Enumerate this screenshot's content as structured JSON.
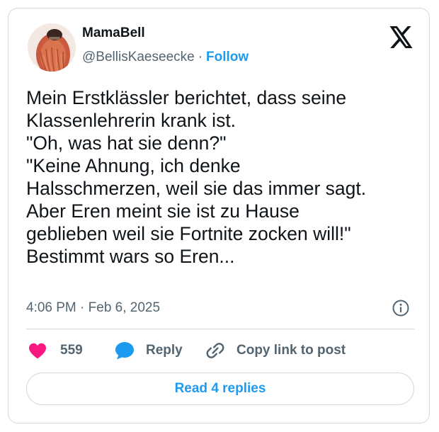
{
  "author": {
    "display_name": "MamaBell",
    "handle": "@BellisKaeseecke",
    "separator": "·",
    "follow_label": "Follow",
    "avatar_icon": "avatar-red-hair"
  },
  "brand": {
    "logo_icon": "x-logo-icon"
  },
  "tweet": {
    "lines": [
      "Mein Erstklässler berichtet, dass seine",
      "Klassenlehrerin krank ist.",
      "\"Oh, was hat sie denn?\"",
      "\"Keine Ahnung, ich denke",
      "Halsschmerzen, weil sie das immer sagt.",
      "Aber Eren meint sie ist zu Hause",
      "geblieben weil sie Fortnite zocken will!\"",
      "Bestimmt wars so Eren..."
    ],
    "timestamp": "4:06 PM · Feb 6, 2025",
    "info_icon": "info-icon"
  },
  "actions": {
    "like": {
      "icon": "heart-icon",
      "count": "559"
    },
    "reply": {
      "icon": "speech-bubble-icon",
      "label": "Reply"
    },
    "copy_link": {
      "icon": "link-icon",
      "label": "Copy link to post"
    }
  },
  "read_replies_label": "Read 4 replies",
  "colors": {
    "text": "#0f1419",
    "secondary": "#536471",
    "accent": "#1d9bf0",
    "like": "#f91880",
    "border": "#cfd9de"
  }
}
